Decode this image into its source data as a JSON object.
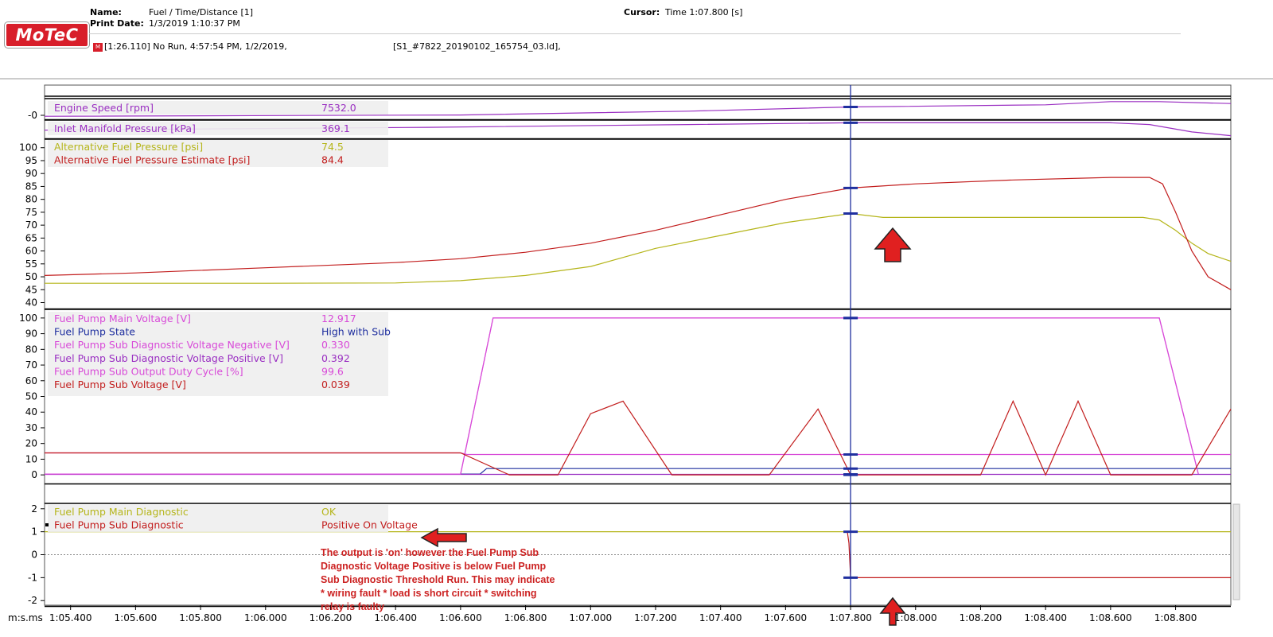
{
  "header": {
    "name_label": "Name:",
    "name_value": "Fuel  / Time/Distance [1]",
    "print_label": "Print Date:",
    "print_value": "1/3/2019 1:10:37 PM",
    "cursor_label": "Cursor:",
    "cursor_value": "Time  1:07.800 [s]",
    "logo_text": "MoTeC",
    "run_info": "[1:26.110] No Run, 4:57:54 PM, 1/2/2019,",
    "file_info": "[S1_#7822_20190102_165754_03.ld],",
    "run_icon": "motec-run-icon"
  },
  "x_axis": {
    "unit_label": "m:s.ms",
    "range": [
      65.32,
      68.97
    ],
    "ticks": [
      65.4,
      65.6,
      65.8,
      66.0,
      66.2,
      66.4,
      66.6,
      66.8,
      67.0,
      67.2,
      67.4,
      67.6,
      67.8,
      68.0,
      68.2,
      68.4,
      68.6,
      68.8
    ],
    "tick_labels": [
      "1:05.400",
      "1:05.600",
      "1:05.800",
      "1:06.000",
      "1:06.200",
      "1:06.400",
      "1:06.600",
      "1:06.800",
      "1:07.000",
      "1:07.200",
      "1:07.400",
      "1:07.600",
      "1:07.800",
      "1:08.000",
      "1:08.200",
      "1:08.400",
      "1:08.600",
      "1:08.800"
    ]
  },
  "cursor": {
    "x": 67.8,
    "color": "#1f2f9f"
  },
  "annotations": {
    "note_lines": [
      "The output is 'on' however the Fuel Pump Sub",
      "Diagnostic Voltage Positive is below Fuel Pump",
      "Sub Diagnostic Threshold Run. This may indicate",
      "* wiring fault * load is short circuit * switching",
      "relay is faulty"
    ],
    "arrow_color": "#e02020"
  },
  "chart_data": [
    {
      "type": "line",
      "panel": "engine",
      "y_tick_labels": [
        "-0"
      ],
      "series": [
        {
          "name": "Engine Speed [rpm]",
          "cursor_value": "7532.0",
          "color": "#9a2fc2",
          "x": [
            65.32,
            66.6,
            67.3,
            67.8,
            68.4,
            68.6,
            68.75,
            68.97
          ],
          "values": [
            6800,
            6900,
            7200,
            7532,
            7700,
            7950,
            7950,
            7800
          ]
        }
      ]
    },
    {
      "type": "line",
      "panel": "manifold",
      "series": [
        {
          "name": "Inlet Manifold Pressure [kPa]",
          "cursor_value": "369.1",
          "color": "#9a2fc2",
          "x": [
            65.32,
            66.5,
            67.3,
            67.8,
            68.6,
            68.72,
            68.85,
            68.97
          ],
          "values": [
            330,
            345,
            360,
            369.1,
            369,
            360,
            320,
            300
          ]
        }
      ]
    },
    {
      "type": "line",
      "panel": "fuel_pressure",
      "ylim": [
        38,
        103
      ],
      "y_ticks": [
        40,
        45,
        50,
        55,
        60,
        65,
        70,
        75,
        80,
        85,
        90,
        95,
        100
      ],
      "series": [
        {
          "name": "Alternative Fuel Pressure [psi]",
          "cursor_value": "74.5",
          "color": "#b5b51a",
          "x": [
            65.32,
            65.6,
            66.0,
            66.4,
            66.6,
            66.8,
            67.0,
            67.2,
            67.4,
            67.6,
            67.8,
            67.9,
            68.1,
            68.4,
            68.7,
            68.75,
            68.8,
            68.85,
            68.9,
            68.97
          ],
          "values": [
            47.5,
            47.5,
            47.5,
            47.6,
            48.5,
            50.5,
            54,
            61,
            66,
            71,
            74.5,
            73,
            73,
            73,
            73,
            72,
            68,
            63,
            59,
            56
          ]
        },
        {
          "name": "Alternative Fuel Pressure Estimate [psi]",
          "cursor_value": "84.4",
          "color": "#c21d1d",
          "x": [
            65.32,
            65.6,
            66.0,
            66.4,
            66.6,
            66.8,
            67.0,
            67.2,
            67.4,
            67.6,
            67.8,
            68.0,
            68.3,
            68.6,
            68.72,
            68.76,
            68.8,
            68.85,
            68.9,
            68.97
          ],
          "values": [
            50.5,
            51.5,
            53.5,
            55.5,
            57,
            59.5,
            63,
            68,
            74,
            80,
            84.4,
            86,
            87.5,
            88.5,
            88.5,
            86,
            75,
            60,
            50,
            45
          ]
        }
      ]
    },
    {
      "type": "line",
      "panel": "pump",
      "ylim": [
        -5,
        105
      ],
      "y_ticks": [
        0,
        10,
        20,
        30,
        40,
        50,
        60,
        70,
        80,
        90,
        100
      ],
      "series": [
        {
          "name": "Fuel Pump Main Voltage [V]",
          "cursor_value": "12.917",
          "color": "#d84ad8",
          "x": [
            65.32,
            66.6,
            66.7,
            68.75,
            68.87
          ],
          "values": [
            0.5,
            0.5,
            100,
            100,
            0.5
          ]
        },
        {
          "name": "Fuel Pump State",
          "cursor_value": "High with Sub",
          "color": "#1f2f9f",
          "x": [
            65.32,
            66.66,
            66.68,
            68.97
          ],
          "values": [
            0.5,
            0.5,
            4,
            4
          ]
        },
        {
          "name": "Fuel Pump Sub Diagnostic Voltage Negative [V]",
          "cursor_value": "0.330",
          "color": "#d84ad8",
          "x": [
            65.32,
            66.6,
            66.62,
            68.97
          ],
          "values": [
            14,
            14,
            13,
            13
          ]
        },
        {
          "name": "Fuel Pump Sub Diagnostic Voltage Positive [V]",
          "cursor_value": "0.392",
          "color": "#9a2fc2",
          "x": [
            65.32,
            66.6,
            66.62,
            68.97
          ],
          "values": [
            0.3,
            0.3,
            0.3,
            0.3
          ]
        },
        {
          "name": "Fuel Pump Sub Output Duty Cycle [%]",
          "cursor_value": "99.6",
          "color": "#d84ad8",
          "x": [
            65.32,
            66.6,
            66.7,
            68.75,
            68.87
          ],
          "values": [
            0.5,
            0.5,
            100,
            100,
            0.5
          ]
        },
        {
          "name": "Fuel Pump Sub Voltage [V]",
          "cursor_value": "0.039",
          "color": "#c21d1d",
          "x": [
            65.32,
            66.6,
            66.75,
            66.9,
            67.0,
            67.1,
            67.25,
            67.55,
            67.7,
            67.8,
            68.2,
            68.3,
            68.4,
            68.5,
            68.6,
            68.85,
            68.97
          ],
          "values": [
            14,
            14,
            0,
            0,
            39,
            47,
            0,
            0,
            42,
            0,
            0,
            47,
            0,
            47,
            0,
            0,
            42
          ]
        }
      ]
    },
    {
      "type": "line",
      "panel": "diagnostic",
      "ylim": [
        -2.2,
        2.2
      ],
      "y_ticks": [
        -2,
        -1,
        0,
        1,
        2
      ],
      "series": [
        {
          "name": "Fuel Pump Main Diagnostic",
          "cursor_value": "OK",
          "color": "#b5b51a",
          "x": [
            65.32,
            68.97
          ],
          "values": [
            1,
            1
          ]
        },
        {
          "name": "Fuel Pump Sub Diagnostic",
          "cursor_value": "Positive On Voltage",
          "color": "#c21d1d",
          "x": [
            67.79,
            67.795,
            67.8,
            68.97
          ],
          "values": [
            1,
            0.5,
            -1,
            -1
          ]
        }
      ]
    }
  ]
}
